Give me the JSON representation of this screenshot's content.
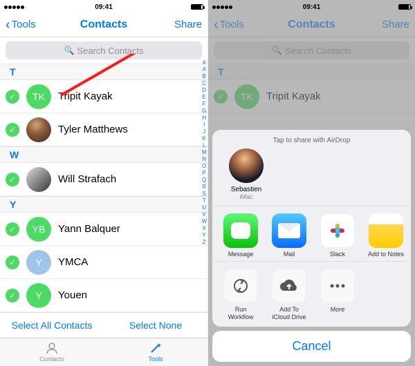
{
  "status": {
    "time": "09:41"
  },
  "nav": {
    "back": "Tools",
    "title": "Contacts",
    "share": "Share"
  },
  "search": {
    "placeholder": "Search Contacts"
  },
  "sections": {
    "t": "T",
    "w": "W",
    "y": "Y"
  },
  "contacts": {
    "c0": {
      "initials": "TK",
      "name": "Tripit Kayak"
    },
    "c1": {
      "name": "Tyler Matthews"
    },
    "c2": {
      "name": "Will Strafach"
    },
    "c3": {
      "initials": "YB",
      "name": "Yann Balquer"
    },
    "c4": {
      "initials": "Y",
      "name": "YMCA"
    },
    "c5": {
      "initials": "Y",
      "name": "Youen"
    }
  },
  "index_letters": "#ABCDEFGHIJKLMNOPQRSTUVWXYZ",
  "actions": {
    "select_all": "Select All Contacts",
    "select_none": "Select None"
  },
  "tabs": {
    "contacts": "Contacts",
    "tools": "Tools"
  },
  "share_sheet": {
    "airdrop_hint": "Tap to share with AirDrop",
    "person": {
      "name": "Sebastien",
      "device": "iMac"
    },
    "apps": {
      "message": "Message",
      "mail": "Mail",
      "slack": "Slack",
      "notes": "Add to Notes"
    },
    "actions": {
      "workflow": "Run\nWorkflow",
      "icloud": "Add To\niCloud Drive",
      "more": "More"
    },
    "cancel": "Cancel"
  }
}
